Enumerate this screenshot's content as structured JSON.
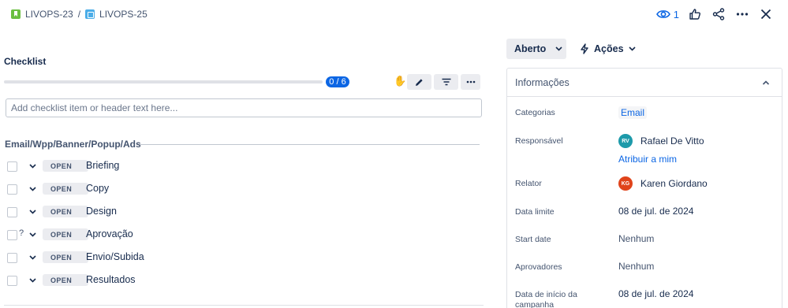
{
  "breadcrumb": {
    "parent": "LIVOPS-23",
    "separator": "/",
    "current": "LIVOPS-25"
  },
  "top_actions": {
    "watch_count": "1"
  },
  "checklist": {
    "title": "Checklist",
    "progress_text": "0 / 6",
    "progress_fraction": 0,
    "input_placeholder": "Add checklist item or header text here...",
    "section_title": "Email/Wpp/Banner/Popup/Ads",
    "items": [
      {
        "status": "OPEN",
        "label": "Briefing",
        "mark": ""
      },
      {
        "status": "OPEN",
        "label": "Copy",
        "mark": ""
      },
      {
        "status": "OPEN",
        "label": "Design",
        "mark": ""
      },
      {
        "status": "OPEN",
        "label": "Aprovação",
        "mark": "?"
      },
      {
        "status": "OPEN",
        "label": "Envio/Subida",
        "mark": ""
      },
      {
        "status": "OPEN",
        "label": "Resultados",
        "mark": ""
      }
    ]
  },
  "status_button": {
    "label": "Aberto"
  },
  "actions_button": {
    "label": "Ações"
  },
  "info_panel": {
    "title": "Informações",
    "fields": {
      "categorias": {
        "label": "Categorias",
        "value": "Email"
      },
      "responsavel": {
        "label": "Responsável",
        "avatar": "RV",
        "avatar_color": "#1d9aaa",
        "value": "Rafael De Vitto",
        "assign_link": "Atribuir a mim"
      },
      "relator": {
        "label": "Relator",
        "avatar": "KG",
        "avatar_color": "#e0441b",
        "value": "Karen Giordano"
      },
      "data_limite": {
        "label": "Data limite",
        "value": "08 de jul. de 2024"
      },
      "start_date": {
        "label": "Start date",
        "value": "Nenhum"
      },
      "aprovadores": {
        "label": "Aprovadores",
        "value": "Nenhum"
      },
      "data_inicio": {
        "label": "Data de início da campanha",
        "value": "08 de jul. de 2024"
      }
    }
  },
  "colors": {
    "accent": "#0c66e4",
    "text": "#172b4d",
    "muted": "#44546f"
  }
}
